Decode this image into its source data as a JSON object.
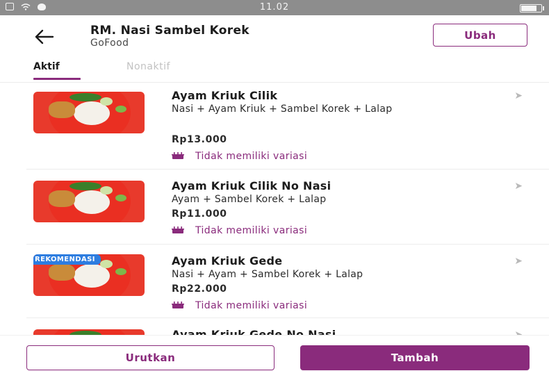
{
  "status_bar": {
    "time": "11.02",
    "battery_level": 0.85
  },
  "header": {
    "title": "RM. Nasi Sambel Korek",
    "subtitle": "GoFood",
    "edit_label": "Ubah"
  },
  "tabs": [
    {
      "label": "Aktif",
      "active": true
    },
    {
      "label": "Nonaktif",
      "active": false
    }
  ],
  "items": [
    {
      "name": "Ayam Kriuk Cilik",
      "desc": "Nasi + Ayam Kriuk + Sambel Korek + Lalap",
      "price": "Rp13.000",
      "variant": "Tidak memiliki variasi",
      "badge": ""
    },
    {
      "name": "Ayam Kriuk Cilik No Nasi",
      "desc": "Ayam + Sambel Korek + Lalap",
      "price": "Rp11.000",
      "variant": "Tidak memiliki variasi",
      "badge": ""
    },
    {
      "name": "Ayam Kriuk Gede",
      "desc": "Nasi + Ayam + Sambel Korek + Lalap",
      "price": "Rp22.000",
      "variant": "Tidak memiliki variasi",
      "badge": "REKOMENDASI"
    },
    {
      "name": "Ayam Kriuk Gede No Nasi",
      "desc": "",
      "price": "",
      "variant": "",
      "badge": ""
    }
  ],
  "bottom": {
    "sort_label": "Urutkan",
    "add_label": "Tambah"
  },
  "colors": {
    "accent": "#8a2b7c",
    "badge": "#2d7de0",
    "status_bar": "#8d8d8d"
  },
  "icons": {
    "back": "arrow-left-icon",
    "chevron": "chevron-right-icon",
    "variant": "pot-icon"
  }
}
